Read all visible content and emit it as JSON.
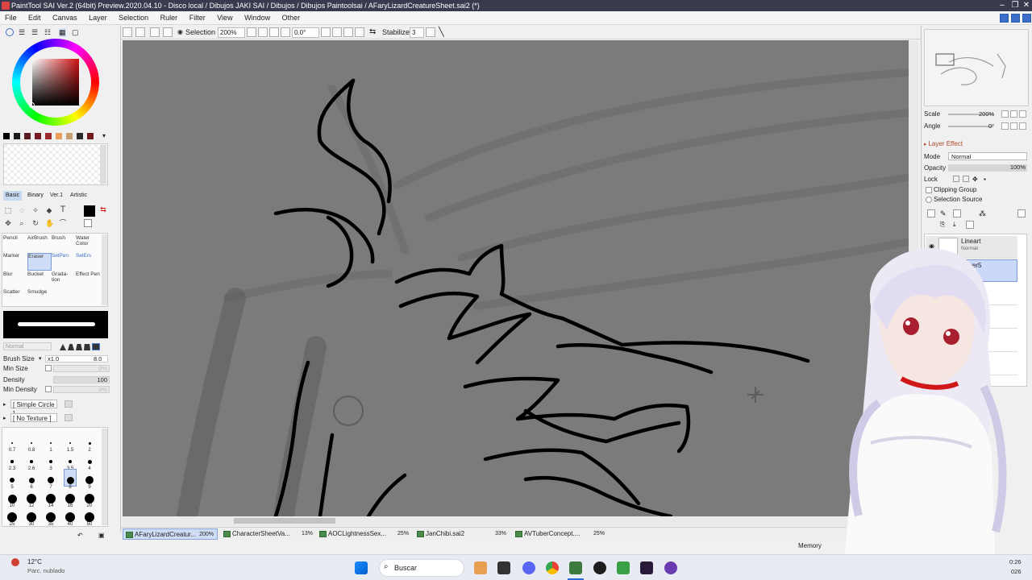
{
  "window": {
    "title": "PaintTool SAI Ver.2 (64bit) Preview.2020.04.10 - Disco local / Dibujos JAKI SAI / Dibujos / Dibujos Paintoolsai / AFaryLizardCreatureSheet.sai2 (*)"
  },
  "menu": [
    "File",
    "Edit",
    "Canvas",
    "Layer",
    "Selection",
    "Ruler",
    "Filter",
    "View",
    "Window",
    "Other"
  ],
  "toolbar": {
    "selection_label": "Selection",
    "zoom": "200%",
    "rotation": "0.0°",
    "stabilizer_label": "Stabilizer",
    "stabilizer_value": "3"
  },
  "colors": {
    "swatches": [
      "#000000",
      "#1a1a1a",
      "#5a1a20",
      "#7a1a24",
      "#9a2a2a",
      "#e8a060",
      "#c8a070",
      "#2a2a2a",
      "#701a1a"
    ],
    "current": "#000000"
  },
  "tool_modes": [
    "Basic",
    "Binary",
    "Ver.1",
    "Artistic"
  ],
  "brush_tools": [
    {
      "label": "Pencil"
    },
    {
      "label": "AirBrush"
    },
    {
      "label": "Brush"
    },
    {
      "label": "Water Color"
    },
    {
      "label": "Marker"
    },
    {
      "label": "Eraser"
    },
    {
      "label": "SelPen"
    },
    {
      "label": "SelErs"
    },
    {
      "label": "Blur"
    },
    {
      "label": "Bucket"
    },
    {
      "label": "Grada-tion"
    },
    {
      "label": "Effect Pen"
    },
    {
      "label": "Scatter"
    },
    {
      "label": "Smudge"
    }
  ],
  "brush_props": {
    "blend_mode": "Normal",
    "size_label": "Brush Size",
    "size_multiplier": "x1.0",
    "size_value": "8.0",
    "min_size_label": "Min Size",
    "min_size_value": "0%",
    "density_label": "Density",
    "density_value": "100",
    "min_density_label": "Min Density",
    "min_density_value": "0%",
    "shape": "[ Simple Circle ]",
    "texture": "[ No Texture ]"
  },
  "brush_sizes": [
    "0.7",
    "0.8",
    "1",
    "1.5",
    "2",
    "2.3",
    "2.6",
    "3",
    "3.5",
    "4",
    "5",
    "6",
    "7",
    "8",
    "9",
    "10",
    "12",
    "14",
    "16",
    "20",
    "25",
    "30",
    "35",
    "40",
    "50"
  ],
  "brush_size_selected": "8",
  "navigator": {
    "scale_label": "Scale",
    "scale_value": "200%",
    "angle_label": "Angle",
    "angle_value": "0°"
  },
  "layer_panel": {
    "effect_label": "Layer Effect",
    "mode_label": "Mode",
    "mode_value": "Normal",
    "opacity_label": "Opacity",
    "opacity_value": "100%",
    "lock_label": "Lock",
    "clipping_label": "Clipping Group",
    "selection_source_label": "Selection Source",
    "layers": [
      {
        "name": "Lineart",
        "mode": "Normal"
      },
      {
        "name": "Layer5",
        "mode": ""
      }
    ]
  },
  "documents": [
    {
      "name": "AFaryLizardCreatur...",
      "zoom": "200%",
      "active": true
    },
    {
      "name": "CharacterSheetVa...",
      "zoom": "13%",
      "active": false
    },
    {
      "name": "AOCLightnessSex...",
      "zoom": "25%",
      "active": false
    },
    {
      "name": "JanChibi.sai2",
      "zoom": "33%",
      "active": false
    },
    {
      "name": "AVTuberConcept....",
      "zoom": "25%",
      "active": false
    }
  ],
  "status": {
    "memory_label": "Memory"
  },
  "taskbar": {
    "weather_temp": "12°C",
    "weather_desc": "Parc. nublado",
    "search_label": "Buscar",
    "time": "0:26",
    "date": "026"
  }
}
